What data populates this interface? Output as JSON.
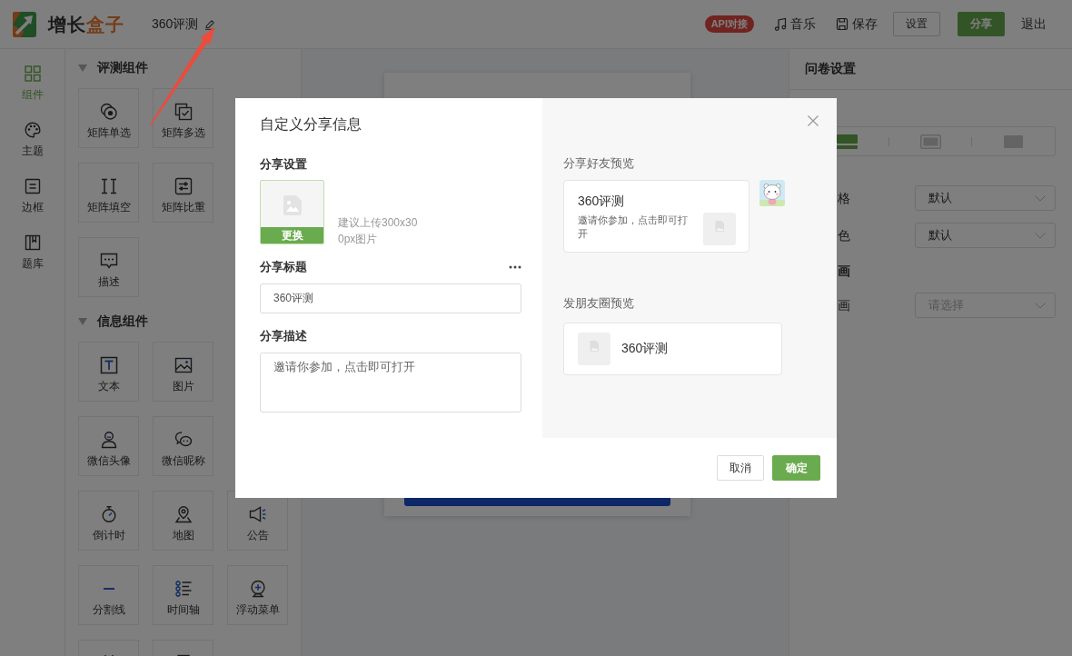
{
  "topbar": {
    "logo": {
      "parts": [
        "增长",
        "盒子"
      ]
    },
    "title": "360评测",
    "badge": "API对接",
    "actions": [
      {
        "kind": "music",
        "label": "音乐"
      },
      {
        "kind": "save",
        "label": "保存"
      }
    ],
    "buttons": [
      {
        "kind": "outline",
        "label": "设置"
      },
      {
        "kind": "primary",
        "label": "分享"
      },
      {
        "kind": "plain",
        "label": "退出"
      }
    ]
  },
  "sidebar": {
    "items": [
      {
        "label": "组件",
        "selected": true
      },
      {
        "label": "主题",
        "selected": false
      },
      {
        "label": "边框",
        "selected": false
      },
      {
        "label": "题库",
        "selected": false
      }
    ]
  },
  "components": {
    "sections": [
      {
        "title": "评测组件",
        "expanded": true,
        "rows": [
          [
            {
              "kind": "tile",
              "label": "矩阵单选"
            },
            {
              "kind": "tile",
              "label": "矩阵多选"
            }
          ],
          [
            {
              "kind": "tile",
              "label": "矩阵填空"
            },
            {
              "kind": "tile",
              "label": "矩阵比重"
            }
          ],
          [
            {
              "kind": "tile",
              "label": "描述"
            }
          ]
        ]
      },
      {
        "title": "信息组件",
        "expanded": true,
        "rows": [
          [
            {
              "kind": "tile",
              "label": "文本"
            },
            {
              "kind": "tile",
              "label": "图片"
            }
          ],
          [
            {
              "kind": "tile",
              "label": "微信头像"
            },
            {
              "kind": "tile",
              "label": "微信昵称"
            }
          ],
          [
            {
              "kind": "tile",
              "label": "倒计时"
            },
            {
              "kind": "tile",
              "label": "地图"
            },
            {
              "kind": "tile",
              "label": "公告"
            }
          ],
          [
            {
              "kind": "tile",
              "label": "分割线"
            },
            {
              "kind": "tile",
              "label": "时间轴"
            },
            {
              "kind": "tile",
              "label": "浮动菜单"
            }
          ],
          [
            {
              "kind": "clipped"
            },
            {
              "kind": "clipped"
            }
          ]
        ]
      }
    ]
  },
  "settings_panel": {
    "title": "问卷设置",
    "layout_options": [
      {
        "selected": true
      },
      {
        "selected": false
      },
      {
        "selected": false
      }
    ],
    "rows": [
      {
        "kind": "select",
        "label": "格",
        "value": "默认"
      },
      {
        "kind": "select",
        "label": "色",
        "value": "默认"
      },
      {
        "kind": "heading",
        "label": "画"
      },
      {
        "kind": "select",
        "label": "画",
        "placeholder": "请选择"
      }
    ]
  },
  "dialog": {
    "title": "自定义分享信息",
    "settings_label": "分享设置",
    "upload": {
      "button": "更换",
      "hint": "建议上传300x300px图片"
    },
    "fields": [
      {
        "kind": "input",
        "label": "分享标题",
        "value": "360评测"
      },
      {
        "kind": "textarea",
        "label": "分享描述",
        "value": "邀请你参加，点击即可打开"
      }
    ],
    "friend_preview": {
      "label": "分享好友预览",
      "title": "360评测",
      "description": "邀请你参加，点击即可打开"
    },
    "moments_preview": {
      "label": "发朋友圈预览",
      "title": "360评测"
    },
    "buttons": [
      {
        "kind": "secondary",
        "label": "取消"
      },
      {
        "kind": "primary",
        "label": "确定"
      }
    ]
  }
}
